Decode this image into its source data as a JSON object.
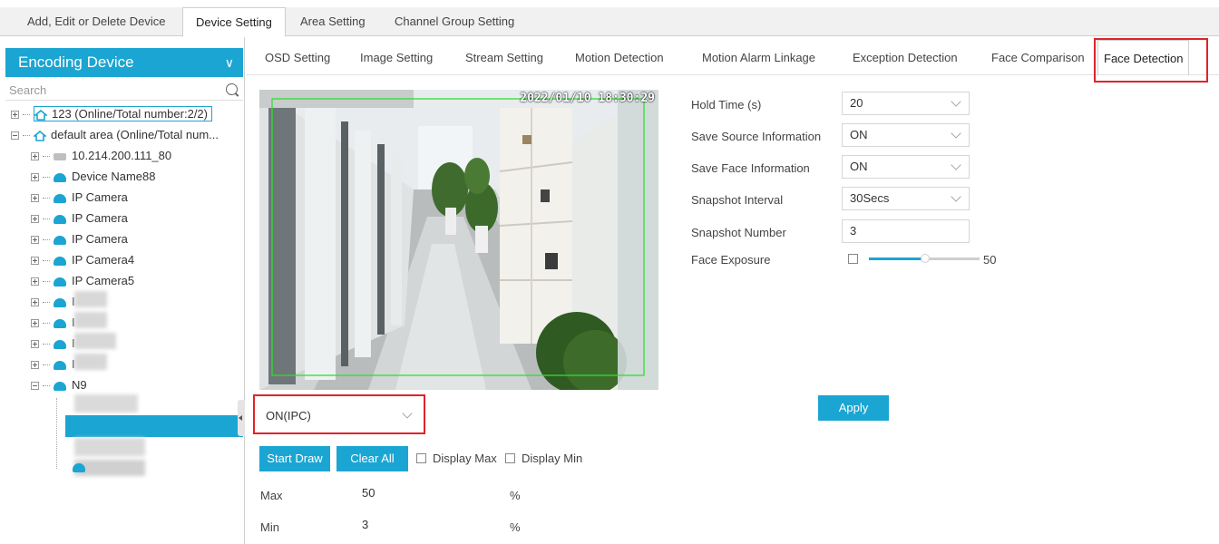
{
  "top_tabs": [
    {
      "label": "Add, Edit or Delete Device"
    },
    {
      "label": "Device Setting"
    },
    {
      "label": "Area Setting"
    },
    {
      "label": "Channel Group Setting"
    }
  ],
  "left_panel": {
    "header": "Encoding Device",
    "search_placeholder": "Search",
    "tree": [
      {
        "label": "123 (Online/Total number:2/2)"
      },
      {
        "label": "default area (Online/Total num..."
      },
      {
        "label": "10.214.200.111_80"
      },
      {
        "label": "Device Name88"
      },
      {
        "label": "IP Camera"
      },
      {
        "label": "IP Camera"
      },
      {
        "label": "IP Camera"
      },
      {
        "label": "IP Camera4"
      },
      {
        "label": "IP Camera5"
      },
      {
        "label": "I"
      },
      {
        "label": "I"
      },
      {
        "label": "I"
      },
      {
        "label": "I"
      },
      {
        "label": "N9"
      }
    ]
  },
  "sub_tabs": [
    {
      "label": "OSD Setting"
    },
    {
      "label": "Image Setting"
    },
    {
      "label": "Stream Setting"
    },
    {
      "label": "Motion Detection"
    },
    {
      "label": "Motion Alarm Linkage"
    },
    {
      "label": "Exception Detection"
    },
    {
      "label": "Face Comparison"
    },
    {
      "label": "Face Detection"
    }
  ],
  "video": {
    "timestamp": "2022/01/10 18:30:29"
  },
  "form": {
    "hold_time_label": "Hold Time (s)",
    "hold_time_value": "20",
    "save_source_label": "Save Source Information",
    "save_source_value": "ON",
    "save_face_label": "Save Face Information",
    "save_face_value": "ON",
    "snapshot_interval_label": "Snapshot Interval",
    "snapshot_interval_value": "30Secs",
    "snapshot_number_label": "Snapshot Number",
    "snapshot_number_value": "3",
    "face_exposure_label": "Face Exposure",
    "face_exposure_value": "50",
    "face_exposure_level_fraction": 0.5
  },
  "detection": {
    "mode_value": "ON(IPC)",
    "start_draw_label": "Start Draw",
    "clear_all_label": "Clear All",
    "display_max_label": "Display Max",
    "display_min_label": "Display Min",
    "max_label": "Max",
    "max_value": "50",
    "min_label": "Min",
    "min_value": "3",
    "percent": "%"
  },
  "apply_label": "Apply",
  "colors": {
    "accent": "#1ba5d2",
    "highlight_box": "#e0232a"
  }
}
